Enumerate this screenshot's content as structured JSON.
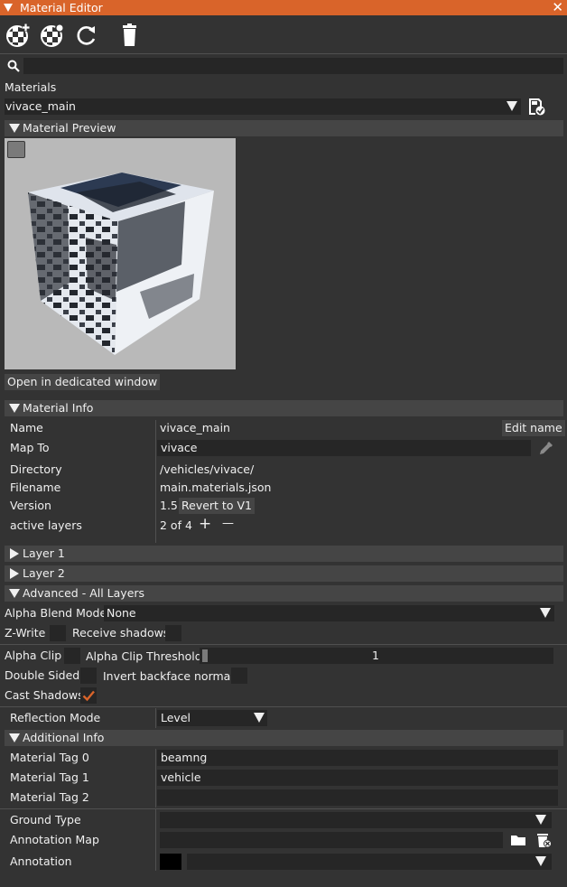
{
  "window": {
    "title": "Material Editor"
  },
  "toolbar": {
    "icons": [
      "add-material-icon",
      "clone-material-icon",
      "refresh-icon",
      "delete-icon"
    ]
  },
  "search": {
    "value": "",
    "placeholder": ""
  },
  "materials": {
    "label": "Materials",
    "selected": "vivace_main"
  },
  "preview": {
    "header": "Material Preview",
    "open_button": "Open in dedicated window"
  },
  "material_info": {
    "header": "Material Info",
    "name_label": "Name",
    "name_value": "vivace_main",
    "edit_name_button": "Edit name",
    "map_to_label": "Map To",
    "map_to_value": "vivace",
    "directory_label": "Directory",
    "directory_value": "/vehicles/vivace/",
    "filename_label": "Filename",
    "filename_value": "main.materials.json",
    "version_label": "Version",
    "version_value": "1.5",
    "revert_button": "Revert to V1",
    "active_layers_label": "active layers",
    "active_layers_value": "2 of 4",
    "plus": "+",
    "minus": "—"
  },
  "layers": [
    {
      "label": "Layer 1"
    },
    {
      "label": "Layer 2"
    }
  ],
  "advanced": {
    "header": "Advanced - All Layers",
    "alpha_blend_label": "Alpha Blend Mode",
    "alpha_blend_value": "None",
    "zwrite_label": "Z-Write",
    "receive_shadows_label": "Receive shadows",
    "alpha_clip_label": "Alpha Clip",
    "alpha_clip_threshold_label": "Alpha Clip Threshold",
    "alpha_clip_threshold_value": "1",
    "double_sided_label": "Double Sided",
    "invert_backface_label": "Invert backface normals",
    "cast_shadows_label": "Cast Shadows",
    "cast_shadows_checked": true,
    "reflection_label": "Reflection Mode",
    "reflection_value": "Level"
  },
  "additional": {
    "header": "Additional Info",
    "tag0_label": "Material Tag 0",
    "tag0_value": "beamng",
    "tag1_label": "Material Tag 1",
    "tag1_value": "vehicle",
    "tag2_label": "Material Tag 2",
    "tag2_value": "",
    "ground_type_label": "Ground Type",
    "ground_type_value": "",
    "annotation_map_label": "Annotation Map",
    "annotation_map_value": "",
    "annotation_label": "Annotation",
    "annotation_value": ""
  },
  "colors": {
    "accent": "#d9642a",
    "background": "#333333",
    "field": "#262626",
    "header": "#454545"
  }
}
